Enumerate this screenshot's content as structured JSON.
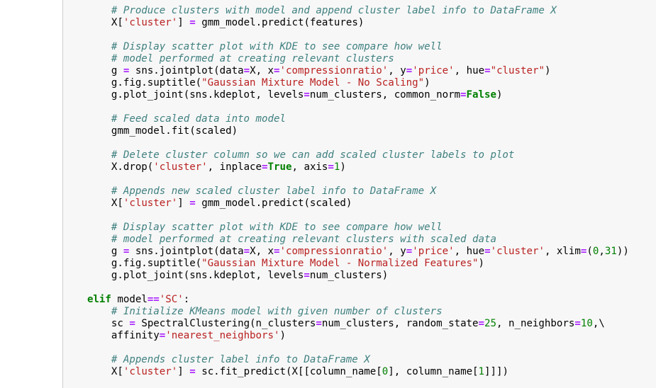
{
  "colors": {
    "comment": "#408080",
    "string": "#ba2121",
    "number": "#008000",
    "operator": "#aa22ff",
    "keyword": "#008000",
    "cell_background": "#f7f7f7",
    "cell_border": "#cfcfcf"
  },
  "code_lines": [
    [
      {
        "t": "c",
        "v": "        # Produce clusters with model and append cluster label info to DataFrame X"
      }
    ],
    [
      {
        "t": "p",
        "v": "        X["
      },
      {
        "t": "s",
        "v": "'cluster'"
      },
      {
        "t": "p",
        "v": "] "
      },
      {
        "t": "o",
        "v": "="
      },
      {
        "t": "p",
        "v": " gmm_model.predict(features)"
      }
    ],
    [
      {
        "t": "p",
        "v": ""
      }
    ],
    [
      {
        "t": "c",
        "v": "        # Display scatter plot with KDE to see compare how well"
      }
    ],
    [
      {
        "t": "c",
        "v": "        # model performed at creating relevant clusters"
      }
    ],
    [
      {
        "t": "p",
        "v": "        g "
      },
      {
        "t": "o",
        "v": "="
      },
      {
        "t": "p",
        "v": " sns.jointplot(data"
      },
      {
        "t": "o",
        "v": "="
      },
      {
        "t": "p",
        "v": "X, x"
      },
      {
        "t": "o",
        "v": "="
      },
      {
        "t": "s",
        "v": "'compressionratio'"
      },
      {
        "t": "p",
        "v": ", y"
      },
      {
        "t": "o",
        "v": "="
      },
      {
        "t": "s",
        "v": "'price'"
      },
      {
        "t": "p",
        "v": ", hue"
      },
      {
        "t": "o",
        "v": "="
      },
      {
        "t": "s",
        "v": "\"cluster\""
      },
      {
        "t": "p",
        "v": ")"
      }
    ],
    [
      {
        "t": "p",
        "v": "        g.fig.suptitle("
      },
      {
        "t": "s",
        "v": "\"Gaussian Mixture Model - No Scaling\""
      },
      {
        "t": "p",
        "v": ")"
      }
    ],
    [
      {
        "t": "p",
        "v": "        g.plot_joint(sns.kdeplot, levels"
      },
      {
        "t": "o",
        "v": "="
      },
      {
        "t": "p",
        "v": "num_clusters, common_norm"
      },
      {
        "t": "o",
        "v": "="
      },
      {
        "t": "k",
        "v": "False"
      },
      {
        "t": "p",
        "v": ")"
      }
    ],
    [
      {
        "t": "p",
        "v": ""
      }
    ],
    [
      {
        "t": "c",
        "v": "        # Feed scaled data into model"
      }
    ],
    [
      {
        "t": "p",
        "v": "        gmm_model.fit(scaled)"
      }
    ],
    [
      {
        "t": "p",
        "v": ""
      }
    ],
    [
      {
        "t": "c",
        "v": "        # Delete cluster column so we can add scaled cluster labels to plot"
      }
    ],
    [
      {
        "t": "p",
        "v": "        X.drop("
      },
      {
        "t": "s",
        "v": "'cluster'"
      },
      {
        "t": "p",
        "v": ", inplace"
      },
      {
        "t": "o",
        "v": "="
      },
      {
        "t": "k",
        "v": "True"
      },
      {
        "t": "p",
        "v": ", axis"
      },
      {
        "t": "o",
        "v": "="
      },
      {
        "t": "n",
        "v": "1"
      },
      {
        "t": "p",
        "v": ")"
      }
    ],
    [
      {
        "t": "p",
        "v": ""
      }
    ],
    [
      {
        "t": "c",
        "v": "        # Appends new scaled cluster label info to DataFrame X"
      }
    ],
    [
      {
        "t": "p",
        "v": "        X["
      },
      {
        "t": "s",
        "v": "'cluster'"
      },
      {
        "t": "p",
        "v": "] "
      },
      {
        "t": "o",
        "v": "="
      },
      {
        "t": "p",
        "v": " gmm_model.predict(scaled)"
      }
    ],
    [
      {
        "t": "p",
        "v": ""
      }
    ],
    [
      {
        "t": "c",
        "v": "        # Display scatter plot with KDE to see compare how well"
      }
    ],
    [
      {
        "t": "c",
        "v": "        # model performed at creating relevant clusters with scaled data"
      }
    ],
    [
      {
        "t": "p",
        "v": "        g "
      },
      {
        "t": "o",
        "v": "="
      },
      {
        "t": "p",
        "v": " sns.jointplot(data"
      },
      {
        "t": "o",
        "v": "="
      },
      {
        "t": "p",
        "v": "X, x"
      },
      {
        "t": "o",
        "v": "="
      },
      {
        "t": "s",
        "v": "'compressionratio'"
      },
      {
        "t": "p",
        "v": ", y"
      },
      {
        "t": "o",
        "v": "="
      },
      {
        "t": "s",
        "v": "'price'"
      },
      {
        "t": "p",
        "v": ", hue"
      },
      {
        "t": "o",
        "v": "="
      },
      {
        "t": "s",
        "v": "'cluster'"
      },
      {
        "t": "p",
        "v": ", xlim"
      },
      {
        "t": "o",
        "v": "="
      },
      {
        "t": "p",
        "v": "("
      },
      {
        "t": "n",
        "v": "0"
      },
      {
        "t": "p",
        "v": ","
      },
      {
        "t": "n",
        "v": "31"
      },
      {
        "t": "p",
        "v": "))"
      }
    ],
    [
      {
        "t": "p",
        "v": "        g.fig.suptitle("
      },
      {
        "t": "s",
        "v": "\"Gaussian Mixture Model - Normalized Features\""
      },
      {
        "t": "p",
        "v": ")"
      }
    ],
    [
      {
        "t": "p",
        "v": "        g.plot_joint(sns.kdeplot, levels"
      },
      {
        "t": "o",
        "v": "="
      },
      {
        "t": "p",
        "v": "num_clusters)"
      }
    ],
    [
      {
        "t": "p",
        "v": ""
      }
    ],
    [
      {
        "t": "k",
        "v": "    elif"
      },
      {
        "t": "p",
        "v": " model"
      },
      {
        "t": "o",
        "v": "=="
      },
      {
        "t": "s",
        "v": "'SC'"
      },
      {
        "t": "p",
        "v": ":"
      }
    ],
    [
      {
        "t": "c",
        "v": "        # Initialize KMeans model with given number of clusters"
      }
    ],
    [
      {
        "t": "p",
        "v": "        sc "
      },
      {
        "t": "o",
        "v": "="
      },
      {
        "t": "p",
        "v": " SpectralClustering(n_clusters"
      },
      {
        "t": "o",
        "v": "="
      },
      {
        "t": "p",
        "v": "num_clusters, random_state"
      },
      {
        "t": "o",
        "v": "="
      },
      {
        "t": "n",
        "v": "25"
      },
      {
        "t": "p",
        "v": ", n_neighbors"
      },
      {
        "t": "o",
        "v": "="
      },
      {
        "t": "n",
        "v": "10"
      },
      {
        "t": "p",
        "v": ",\\"
      }
    ],
    [
      {
        "t": "p",
        "v": "        affinity"
      },
      {
        "t": "o",
        "v": "="
      },
      {
        "t": "s",
        "v": "'nearest_neighbors'"
      },
      {
        "t": "p",
        "v": ")"
      }
    ],
    [
      {
        "t": "p",
        "v": ""
      }
    ],
    [
      {
        "t": "c",
        "v": "        # Appends cluster label info to DataFrame X"
      }
    ],
    [
      {
        "t": "p",
        "v": "        X["
      },
      {
        "t": "s",
        "v": "'cluster'"
      },
      {
        "t": "p",
        "v": "] "
      },
      {
        "t": "o",
        "v": "="
      },
      {
        "t": "p",
        "v": " sc.fit_predict(X[[column_name["
      },
      {
        "t": "n",
        "v": "0"
      },
      {
        "t": "p",
        "v": "], column_name["
      },
      {
        "t": "n",
        "v": "1"
      },
      {
        "t": "p",
        "v": "]]])"
      }
    ]
  ]
}
